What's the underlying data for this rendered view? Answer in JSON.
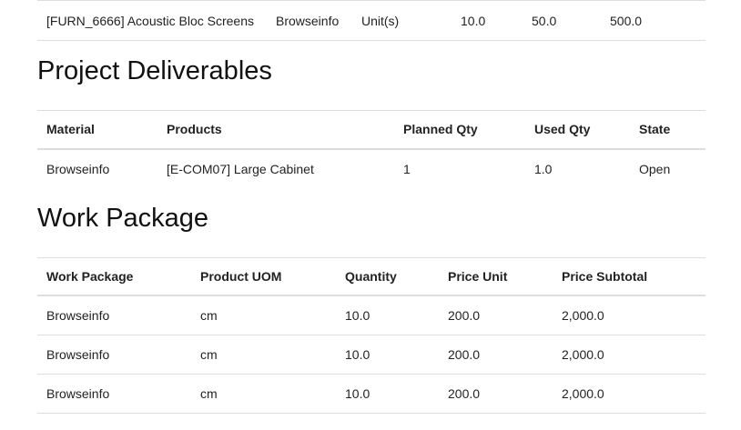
{
  "top_row": {
    "product": "[FURN_6666] Acoustic Bloc Screens",
    "material": "Browseinfo",
    "uom": "Unit(s)",
    "qty": "10.0",
    "price": "50.0",
    "subtotal": "500.0"
  },
  "deliverables": {
    "title": "Project Deliverables",
    "headers": [
      "Material",
      "Products",
      "Planned Qty",
      "Used Qty",
      "State"
    ],
    "rows": [
      [
        "Browseinfo",
        "[E-COM07] Large Cabinet",
        "1",
        "1.0",
        "Open"
      ]
    ]
  },
  "work_package": {
    "title": "Work Package",
    "headers": [
      "Work Package",
      "Product UOM",
      "Quantity",
      "Price Unit",
      "Price Subtotal"
    ],
    "rows": [
      [
        "Browseinfo",
        "cm",
        "10.0",
        "200.0",
        "2,000.0"
      ],
      [
        "Browseinfo",
        "cm",
        "10.0",
        "200.0",
        "2,000.0"
      ],
      [
        "Browseinfo",
        "cm",
        "10.0",
        "200.0",
        "2,000.0"
      ]
    ]
  }
}
